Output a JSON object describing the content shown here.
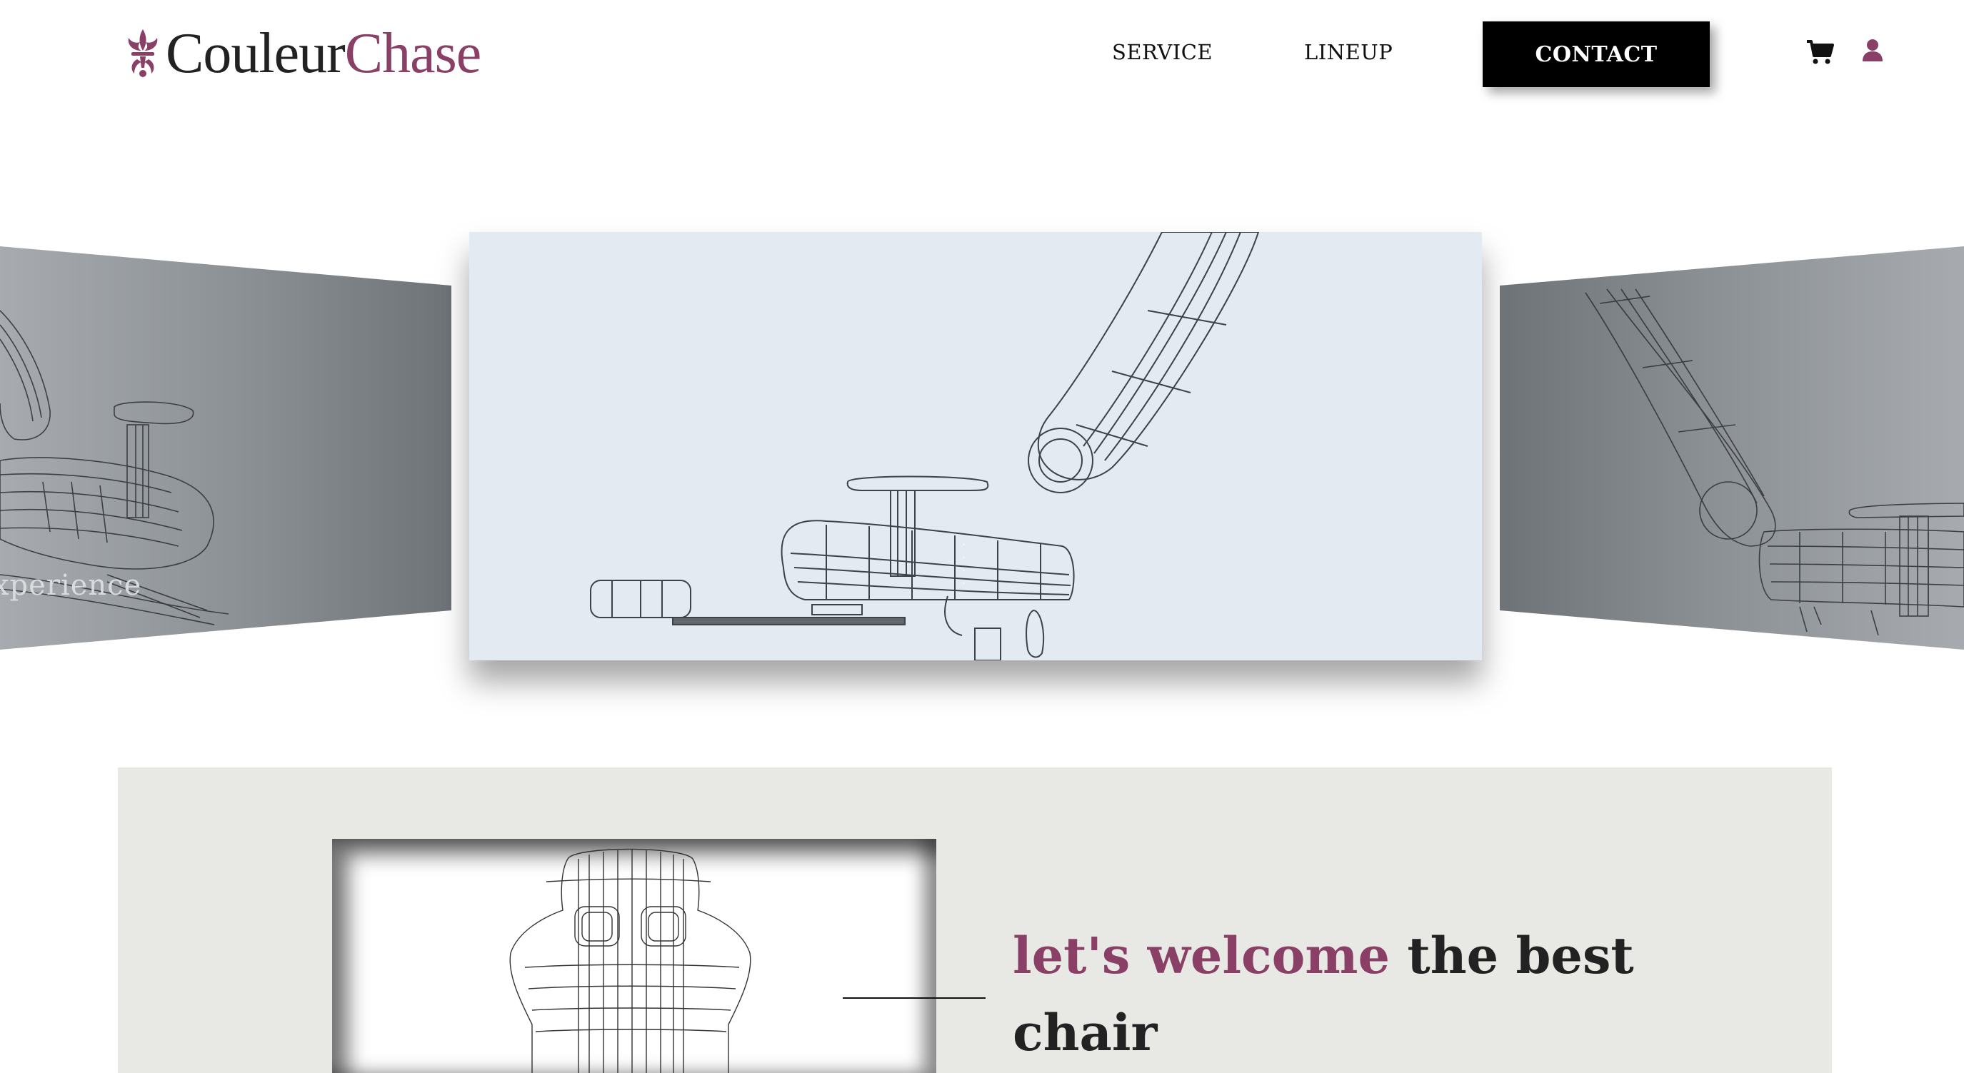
{
  "brand": {
    "name_part1": "Couleur",
    "name_part2": "Chase",
    "accent_color": "#8a3f66"
  },
  "nav": {
    "service": "SERVICE",
    "lineup": "LINEUP",
    "contact": "CONTACT",
    "cart_icon": "cart-icon",
    "user_icon": "user-icon"
  },
  "carousel": {
    "left_caption": "xperience",
    "slides": [
      "side-view-chair-left",
      "side-view-chair-center",
      "side-view-chair-right"
    ]
  },
  "welcome": {
    "headline_accent": "let's welcome",
    "headline_rest": " the best chair",
    "background": "#e8e8e5"
  }
}
